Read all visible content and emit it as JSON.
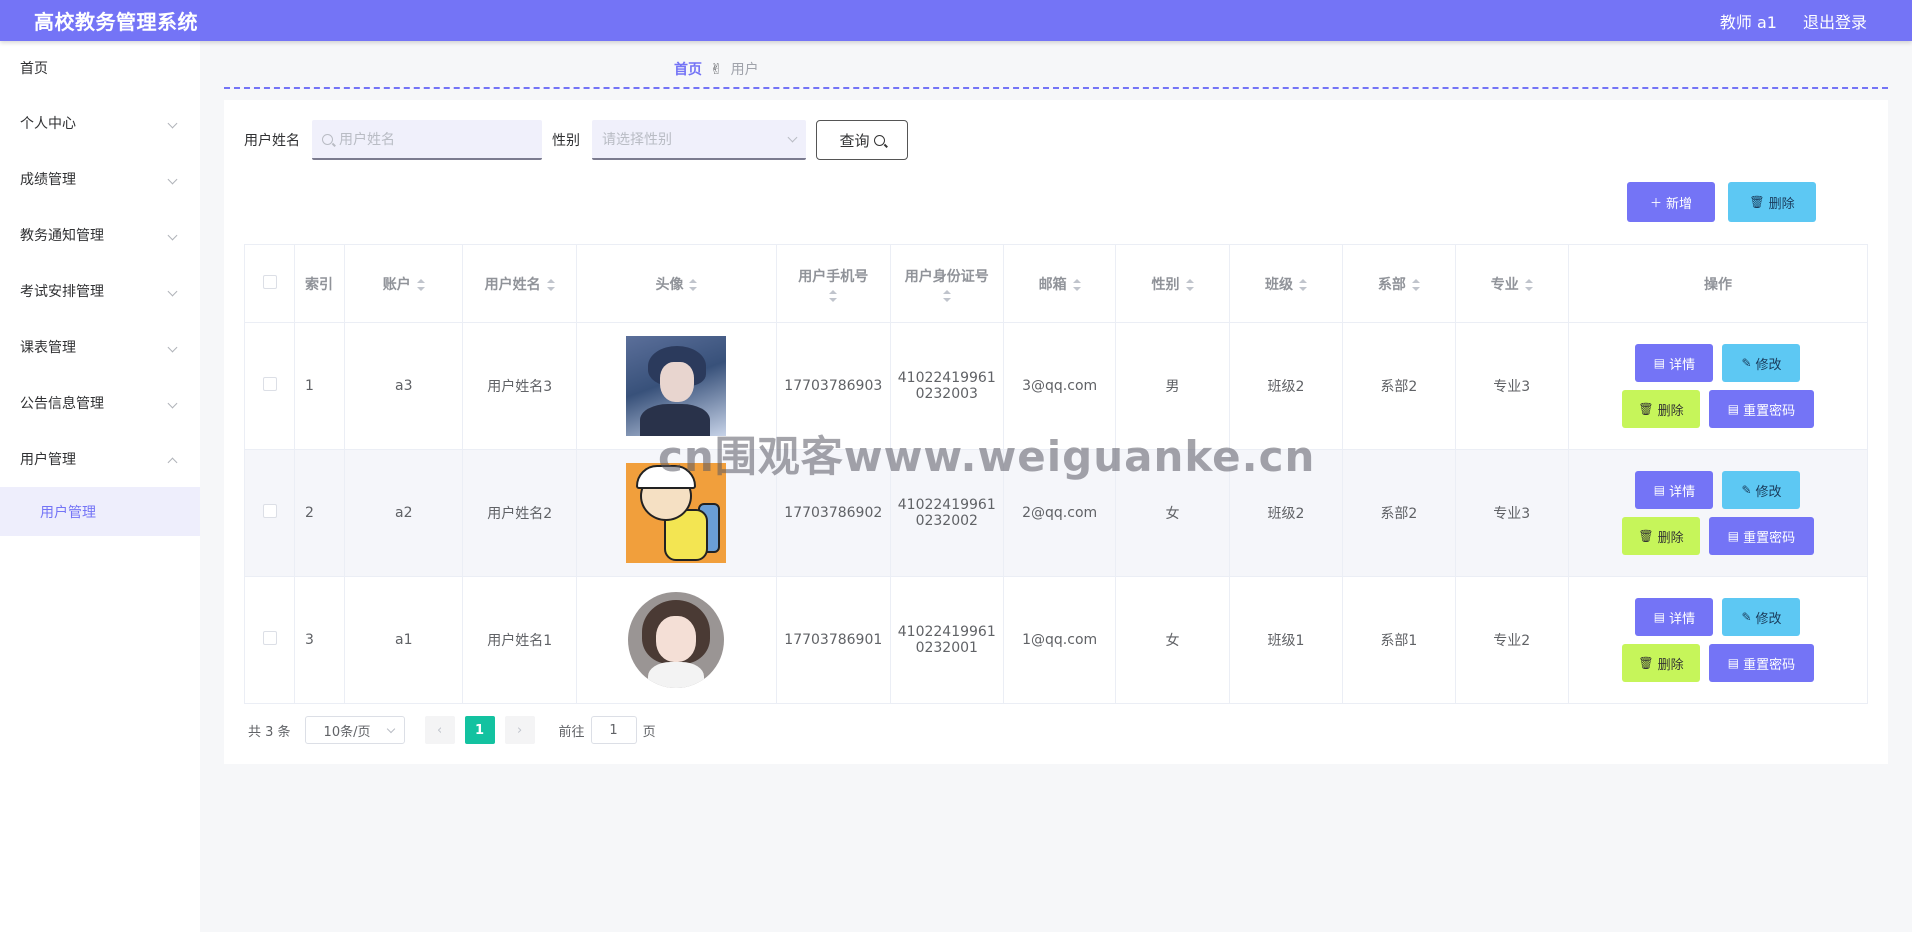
{
  "header": {
    "title": "高校教务管理系统",
    "user": "教师 a1",
    "logout": "退出登录"
  },
  "sidebar": {
    "items": [
      {
        "label": "首页"
      },
      {
        "label": "个人中心"
      },
      {
        "label": "成绩管理"
      },
      {
        "label": "教务通知管理"
      },
      {
        "label": "考试安排管理"
      },
      {
        "label": "课表管理"
      },
      {
        "label": "公告信息管理"
      },
      {
        "label": "用户管理"
      }
    ],
    "submenu_active": "用户管理"
  },
  "breadcrumb": {
    "home": "首页",
    "separator_icon": "hand-icon",
    "current": "用户"
  },
  "search": {
    "name_label": "用户姓名",
    "name_placeholder": "用户姓名",
    "sex_label": "性别",
    "sex_placeholder": "请选择性别",
    "query_label": "查询"
  },
  "actions": {
    "add_label": "新增",
    "delete_label": "删除"
  },
  "table": {
    "columns": [
      "索引",
      "账户",
      "用户姓名",
      "头像",
      "用户手机号",
      "用户身份证号",
      "邮箱",
      "性别",
      "班级",
      "系部",
      "专业",
      "操作"
    ],
    "rows": [
      {
        "index": "1",
        "account": "a3",
        "name": "用户姓名3",
        "avatar": "avatar-anime-boy",
        "phone": "17703786903",
        "id1": "41022419961",
        "id2": "0232003",
        "email": "3@qq.com",
        "sex": "男",
        "class": "班级2",
        "dept": "系部2",
        "major": "专业3"
      },
      {
        "index": "2",
        "account": "a2",
        "name": "用户姓名2",
        "avatar": "avatar-cartoon-kid",
        "phone": "17703786902",
        "id1": "41022419961",
        "id2": "0232002",
        "email": "2@qq.com",
        "sex": "女",
        "class": "班级2",
        "dept": "系部2",
        "major": "专业3"
      },
      {
        "index": "3",
        "account": "a1",
        "name": "用户姓名1",
        "avatar": "avatar-girl",
        "phone": "17703786901",
        "id1": "41022419961",
        "id2": "0232001",
        "email": "1@qq.com",
        "sex": "女",
        "class": "班级1",
        "dept": "系部1",
        "major": "专业2"
      }
    ],
    "ops": {
      "detail": "详情",
      "edit": "修改",
      "delete": "删除",
      "reset": "重置密码"
    }
  },
  "pagination": {
    "total": "共 3 条",
    "page_size": "10条/页",
    "current_page": "1",
    "goto_label": "前往",
    "goto_value": "1",
    "page_suffix": "页"
  },
  "watermark": "cn围观客www.weiguanke.cn",
  "colors": {
    "primary": "#7474f6",
    "info": "#5dc8f3",
    "lime": "#c6f55a",
    "page_active": "#13c2a0"
  }
}
